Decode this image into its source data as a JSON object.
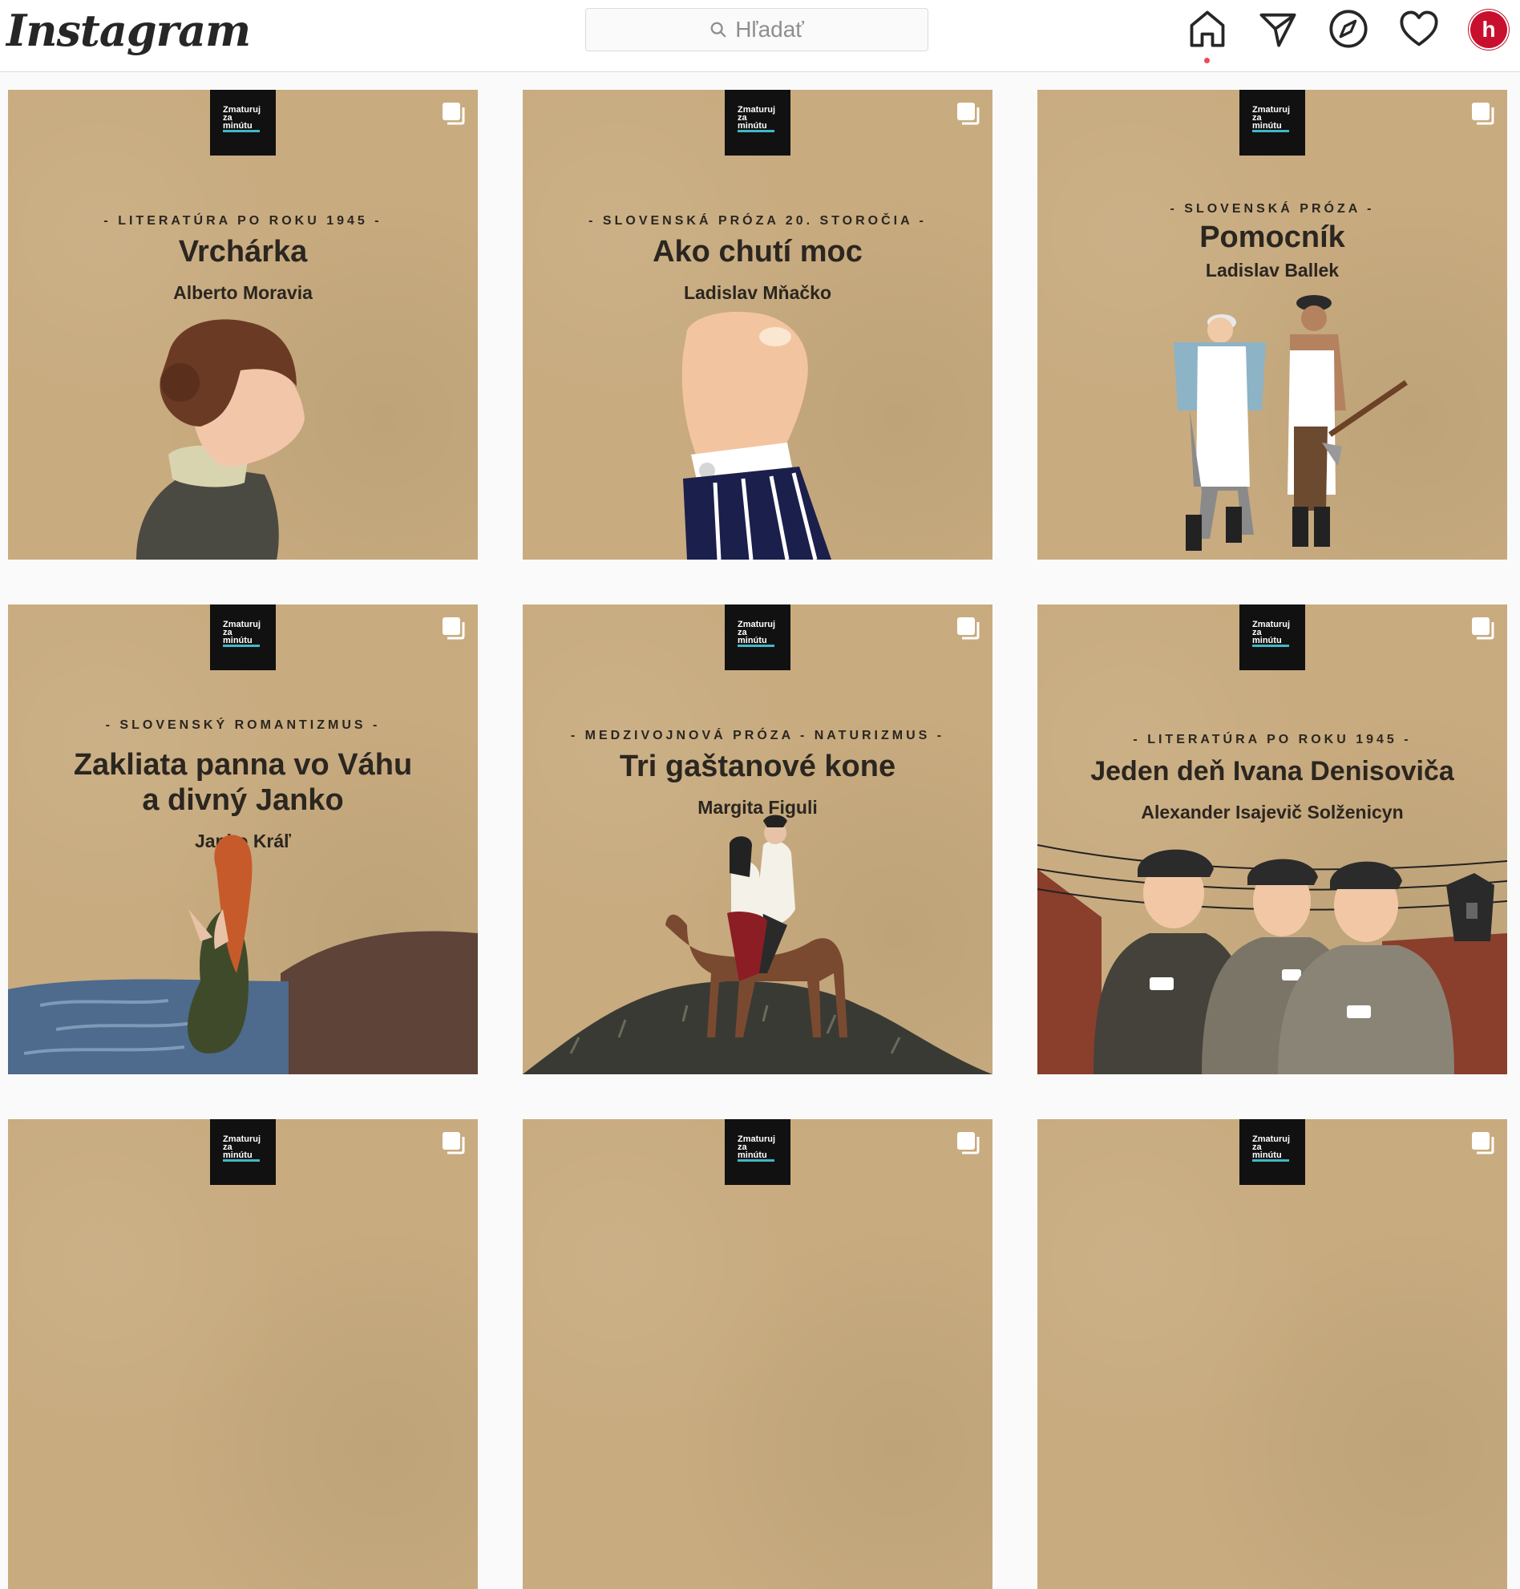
{
  "header": {
    "logo": "Instagram",
    "search_placeholder": "Hľadať",
    "avatar_initial": "h",
    "icons": [
      "home-icon",
      "direct-icon",
      "explore-icon",
      "activity-heart-icon"
    ],
    "notification_color": "#ed4956",
    "avatar_color": "#c8102e"
  },
  "brand": {
    "line1": "Zmaturuj",
    "line2": "za",
    "line3": "minútu"
  },
  "posts": [
    {
      "kicker": "- LITERATÚRA PO ROKU 1945 -",
      "title": "Vrchárka",
      "author": "Alberto Moravia",
      "illustration": "woman-profile"
    },
    {
      "kicker": "- SLOVENSKÁ PRÓZA 20. STOROČIA -",
      "title": "Ako chutí moc",
      "author": "Ladislav Mňačko",
      "illustration": "raised-fist"
    },
    {
      "kicker": "- SLOVENSKÁ PRÓZA -",
      "title": "Pomocník",
      "author": "Ladislav Ballek",
      "illustration": "two-butchers"
    },
    {
      "kicker": "- SLOVENSKÝ ROMANTIZMUS -",
      "title_line1": "Zakliata panna vo Váhu",
      "title_line2": "a divný Janko",
      "author": "Janko Kráľ",
      "illustration": "woman-in-river"
    },
    {
      "kicker": "- MEDZIVOJNOVÁ PRÓZA - NATURIZMUS -",
      "title": "Tri gaštanové kone",
      "author": "Margita Figuli",
      "illustration": "couple-on-horse"
    },
    {
      "kicker": "- LITERATÚRA PO ROKU 1945 -",
      "title": "Jeden deň Ivana Denisoviča",
      "author": "Alexander Isajevič Solženicyn",
      "illustration": "prisoners-camp"
    }
  ],
  "colors": {
    "card_background": "#c8ab7f",
    "brand_box": "#111111",
    "brand_accent": "#3fb8c8"
  }
}
